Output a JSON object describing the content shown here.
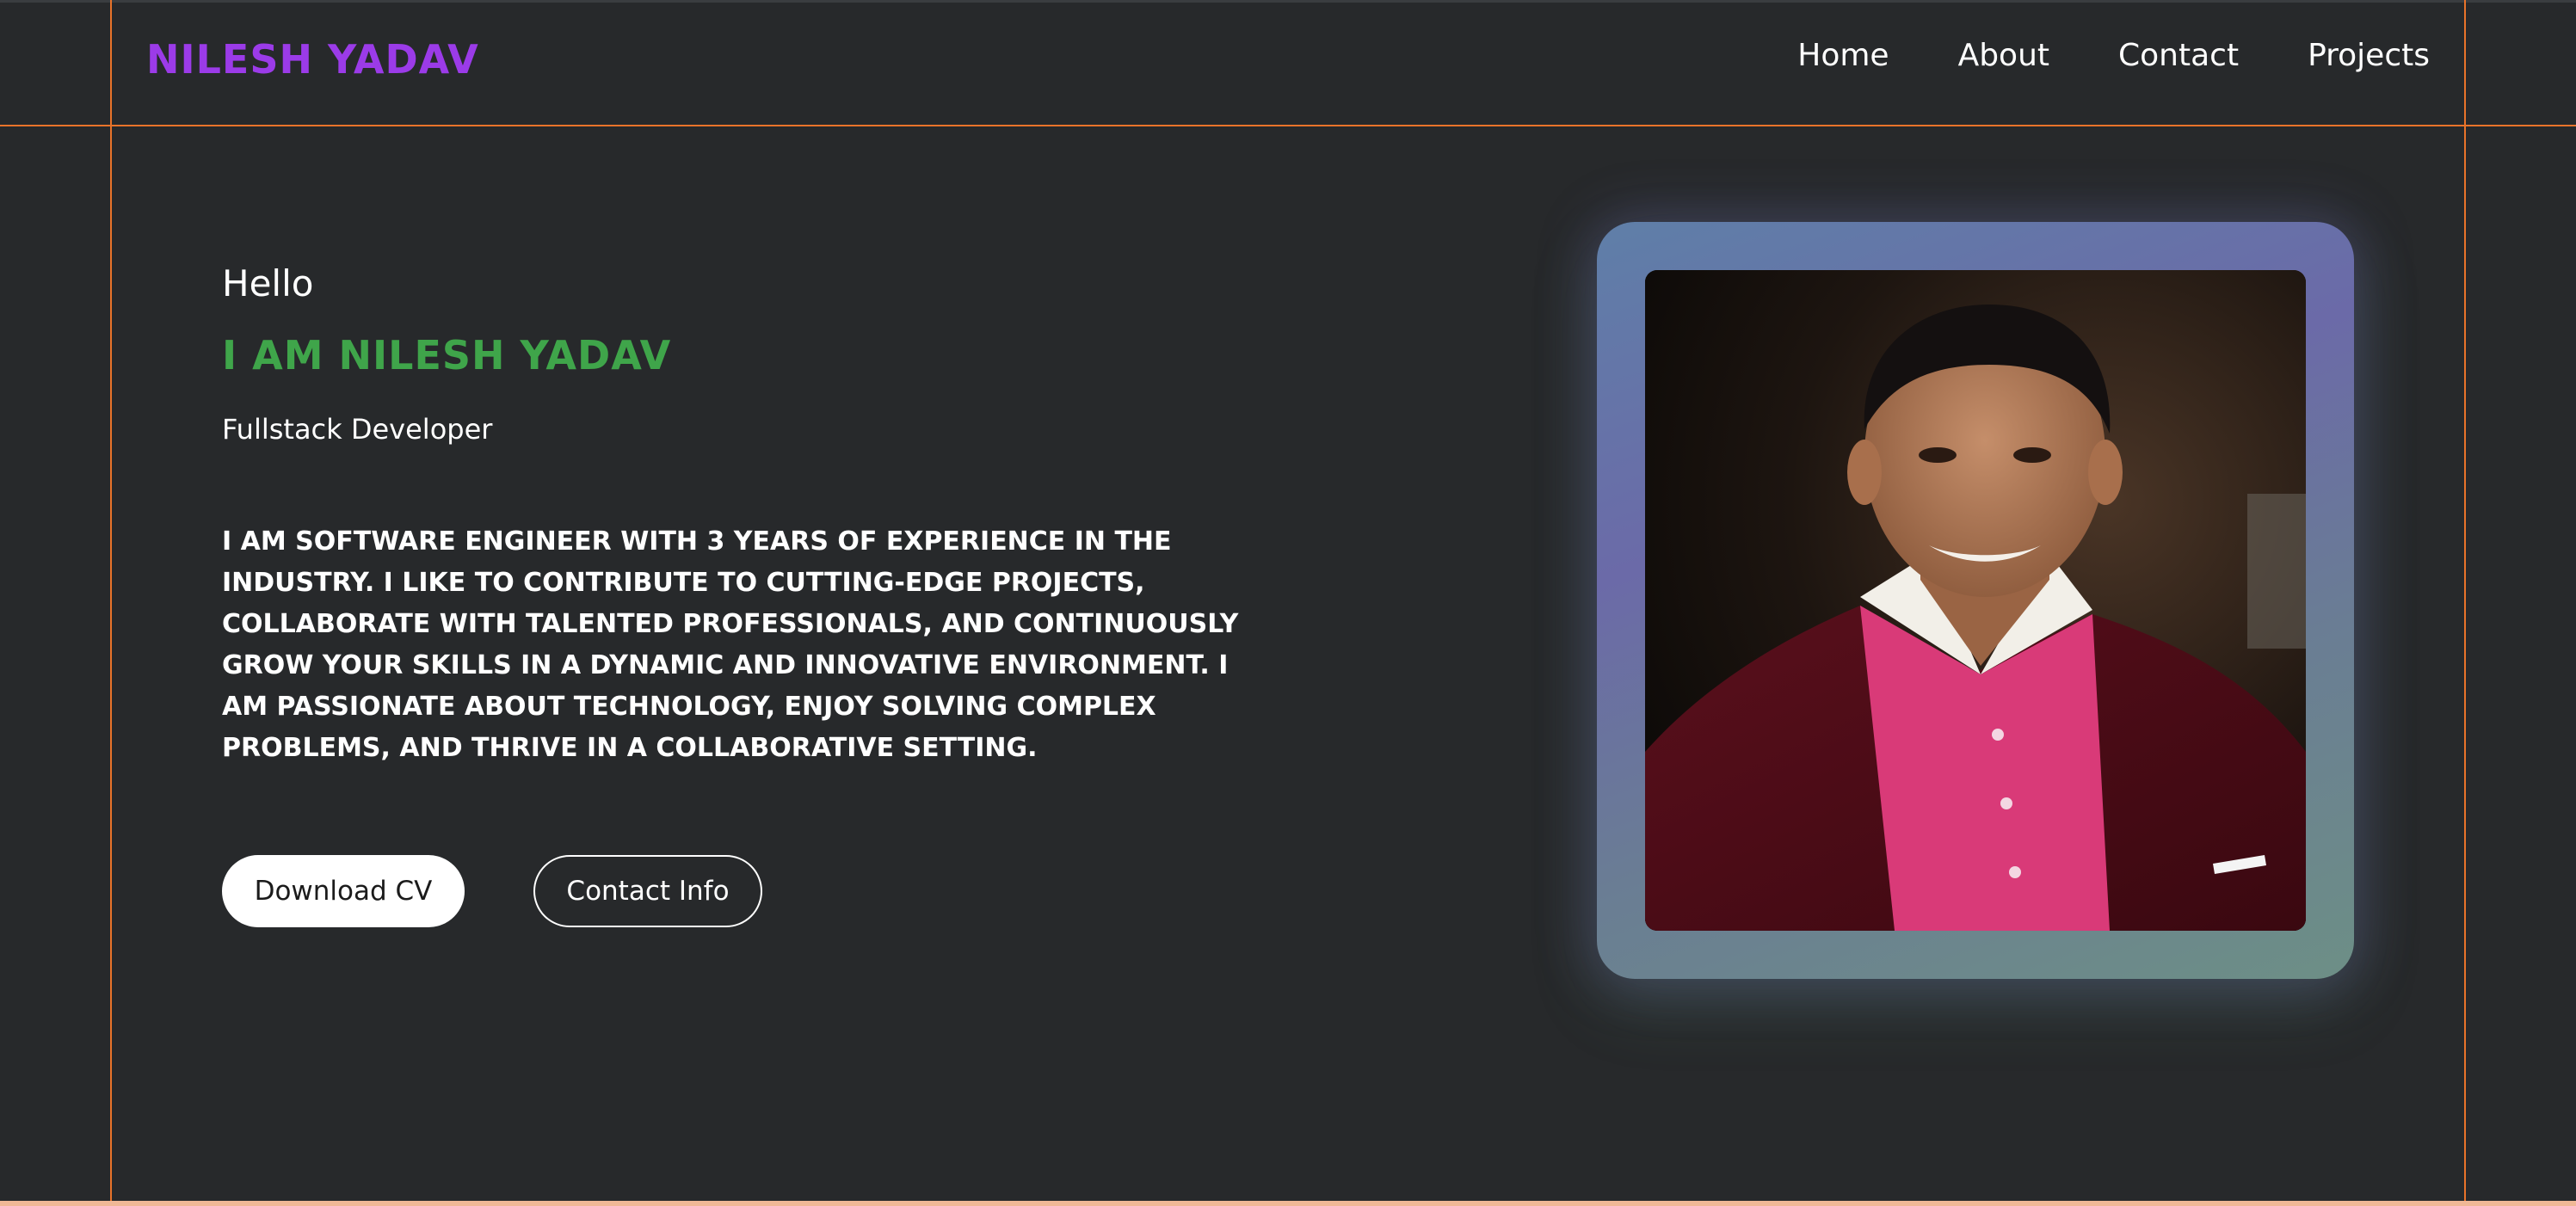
{
  "header": {
    "logo": "NILESH YADAV",
    "nav": [
      {
        "label": "Home"
      },
      {
        "label": "About"
      },
      {
        "label": "Contact"
      },
      {
        "label": "Projects"
      }
    ]
  },
  "hero": {
    "greeting": "Hello",
    "name": "I AM NILESH YADAV",
    "role": "Fullstack Developer",
    "bio": "I AM SOFTWARE ENGINEER WITH 3 YEARS OF EXPERIENCE IN THE INDUSTRY. I LIKE TO CONTRIBUTE TO CUTTING-EDGE PROJECTS, COLLABORATE WITH TALENTED PROFESSIONALS, AND CONTINUOUSLY GROW YOUR SKILLS IN A DYNAMIC AND INNOVATIVE ENVIRONMENT. I AM PASSIONATE ABOUT TECHNOLOGY, ENJOY SOLVING COMPLEX PROBLEMS, AND THRIVE IN A COLLABORATIVE SETTING.",
    "buttons": {
      "download_cv": "Download CV",
      "contact_info": "Contact Info"
    }
  },
  "colors": {
    "background": "#27292b",
    "logo": "#9b3be8",
    "name": "#3fa54a",
    "guide_lines": "#e8732a"
  }
}
